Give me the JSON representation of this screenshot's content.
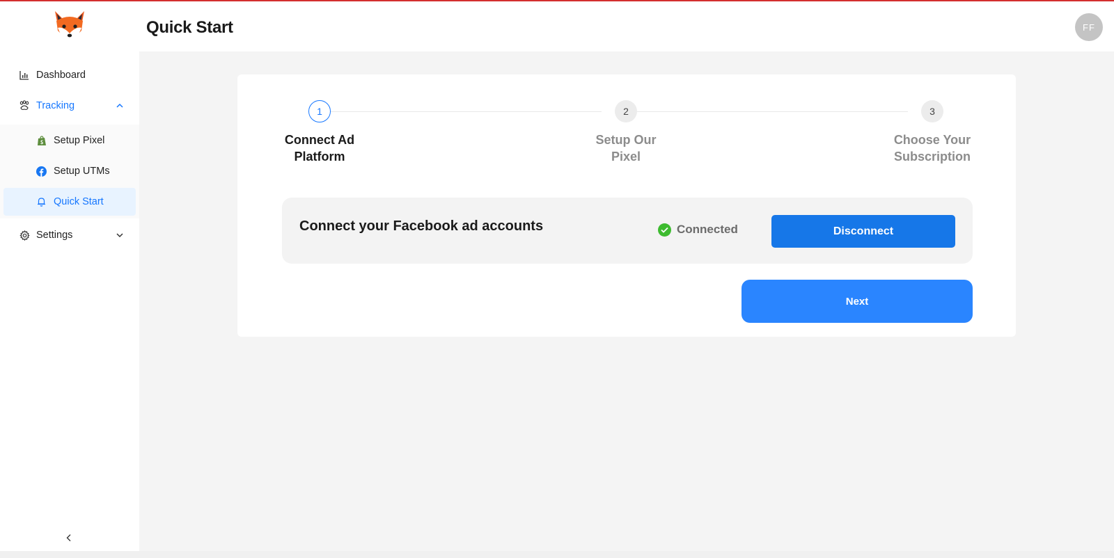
{
  "header": {
    "title": "Quick Start",
    "avatar_initials": "FF"
  },
  "sidebar": {
    "logo": "fox-logo",
    "items": [
      {
        "label": "Dashboard",
        "icon": "bar-chart-icon"
      },
      {
        "label": "Tracking",
        "icon": "paw-icon",
        "expanded": true
      },
      {
        "label": "Settings",
        "icon": "gear-icon",
        "expanded": false
      }
    ],
    "tracking_sub": [
      {
        "label": "Setup Pixel",
        "icon": "shopify-icon"
      },
      {
        "label": "Setup UTMs",
        "icon": "facebook-icon"
      },
      {
        "label": "Quick Start",
        "icon": "bell-icon",
        "selected": true
      }
    ]
  },
  "stepper": {
    "current": 1,
    "steps": [
      {
        "number": "1",
        "title_line1": "Connect Ad",
        "title_line2": "Platform"
      },
      {
        "number": "2",
        "title_line1": "Setup Our",
        "title_line2": "Pixel"
      },
      {
        "number": "3",
        "title_line1": "Choose Your",
        "title_line2": "Subscription"
      }
    ]
  },
  "connect": {
    "title": "Connect your Facebook ad accounts",
    "status": "Connected",
    "disconnect_label": "Disconnect"
  },
  "next_label": "Next",
  "colors": {
    "primary": "#1677ff",
    "success": "#3dbb2f",
    "accent_line": "#d32f2f"
  }
}
